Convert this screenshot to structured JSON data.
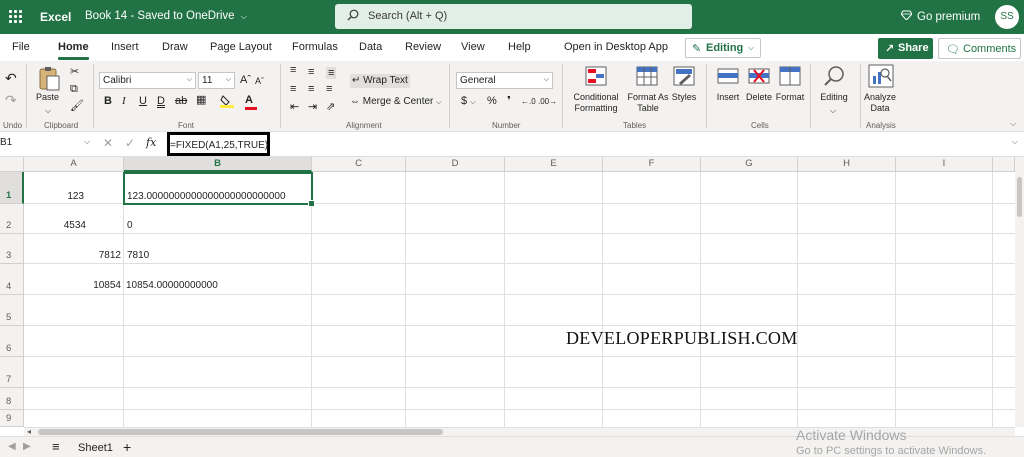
{
  "titlebar": {
    "app_name": "Excel",
    "doc_title": "Book 14  -  Saved to OneDrive",
    "search_placeholder": "Search (Alt + Q)",
    "premium": "Go premium",
    "avatar_initials": "SS"
  },
  "tabs": [
    "File",
    "Home",
    "Insert",
    "Draw",
    "Page Layout",
    "Formulas",
    "Data",
    "Review",
    "View",
    "Help",
    "Open in Desktop App"
  ],
  "active_tab": "Home",
  "editing_mode": "Editing",
  "share_label": "Share",
  "comments_label": "Comments",
  "ribbon": {
    "undo_label": "Undo",
    "paste_label": "Paste",
    "clipboard_label": "Clipboard",
    "font_name": "Calibri",
    "font_size": "11",
    "font_label": "Font",
    "wrap_text": "Wrap Text",
    "merge_center": "Merge & Center",
    "alignment_label": "Alignment",
    "number_format": "General",
    "number_label": "Number",
    "conditional_formatting": "Conditional Formatting",
    "format_as_table": "Format As Table",
    "styles": "Styles",
    "tables_label": "Tables",
    "insert": "Insert",
    "delete": "Delete",
    "format": "Format",
    "cells_label": "Cells",
    "editing": "Editing",
    "analyze_data": "Analyze Data",
    "analysis_label": "Analysis"
  },
  "formula_bar": {
    "name_box": "B1",
    "fx": "fx",
    "formula": "=FIXED(A1,25,TRUE)"
  },
  "grid": {
    "columns": [
      "A",
      "B",
      "C",
      "D",
      "E",
      "F",
      "G",
      "H",
      "I"
    ],
    "rows": [
      "1",
      "2",
      "3",
      "4",
      "5",
      "6",
      "7",
      "8",
      "9"
    ],
    "selected_cell": "B1",
    "cells": {
      "A1": "123",
      "B1": "123.0000000000000000000000000",
      "A2": "4534",
      "B2": "0",
      "A3": "7812",
      "B3": "7810",
      "A4": "10854",
      "B4": "10854.00000000000"
    },
    "watermark": "DEVELOPERPUBLISH.COM"
  },
  "sheets": [
    "Sheet1"
  ],
  "activate_windows": {
    "title": "Activate Windows",
    "subtitle": "Go to PC settings to activate Windows."
  }
}
